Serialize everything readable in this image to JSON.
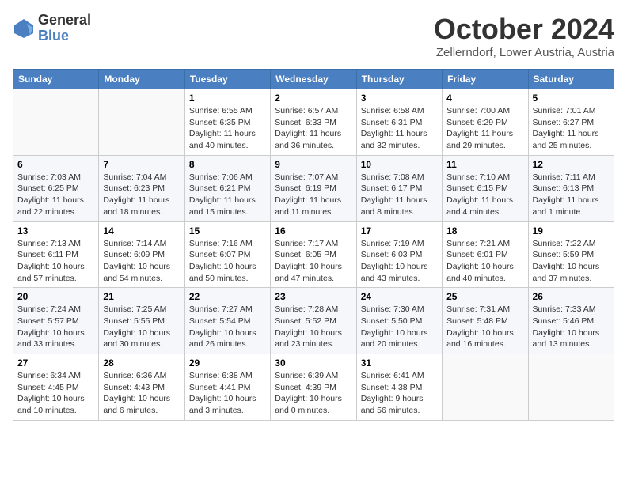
{
  "logo": {
    "general": "General",
    "blue": "Blue"
  },
  "title": "October 2024",
  "location": "Zellerndorf, Lower Austria, Austria",
  "days_of_week": [
    "Sunday",
    "Monday",
    "Tuesday",
    "Wednesday",
    "Thursday",
    "Friday",
    "Saturday"
  ],
  "weeks": [
    [
      {
        "day": "",
        "info": ""
      },
      {
        "day": "",
        "info": ""
      },
      {
        "day": "1",
        "info": "Sunrise: 6:55 AM\nSunset: 6:35 PM\nDaylight: 11 hours and 40 minutes."
      },
      {
        "day": "2",
        "info": "Sunrise: 6:57 AM\nSunset: 6:33 PM\nDaylight: 11 hours and 36 minutes."
      },
      {
        "day": "3",
        "info": "Sunrise: 6:58 AM\nSunset: 6:31 PM\nDaylight: 11 hours and 32 minutes."
      },
      {
        "day": "4",
        "info": "Sunrise: 7:00 AM\nSunset: 6:29 PM\nDaylight: 11 hours and 29 minutes."
      },
      {
        "day": "5",
        "info": "Sunrise: 7:01 AM\nSunset: 6:27 PM\nDaylight: 11 hours and 25 minutes."
      }
    ],
    [
      {
        "day": "6",
        "info": "Sunrise: 7:03 AM\nSunset: 6:25 PM\nDaylight: 11 hours and 22 minutes."
      },
      {
        "day": "7",
        "info": "Sunrise: 7:04 AM\nSunset: 6:23 PM\nDaylight: 11 hours and 18 minutes."
      },
      {
        "day": "8",
        "info": "Sunrise: 7:06 AM\nSunset: 6:21 PM\nDaylight: 11 hours and 15 minutes."
      },
      {
        "day": "9",
        "info": "Sunrise: 7:07 AM\nSunset: 6:19 PM\nDaylight: 11 hours and 11 minutes."
      },
      {
        "day": "10",
        "info": "Sunrise: 7:08 AM\nSunset: 6:17 PM\nDaylight: 11 hours and 8 minutes."
      },
      {
        "day": "11",
        "info": "Sunrise: 7:10 AM\nSunset: 6:15 PM\nDaylight: 11 hours and 4 minutes."
      },
      {
        "day": "12",
        "info": "Sunrise: 7:11 AM\nSunset: 6:13 PM\nDaylight: 11 hours and 1 minute."
      }
    ],
    [
      {
        "day": "13",
        "info": "Sunrise: 7:13 AM\nSunset: 6:11 PM\nDaylight: 10 hours and 57 minutes."
      },
      {
        "day": "14",
        "info": "Sunrise: 7:14 AM\nSunset: 6:09 PM\nDaylight: 10 hours and 54 minutes."
      },
      {
        "day": "15",
        "info": "Sunrise: 7:16 AM\nSunset: 6:07 PM\nDaylight: 10 hours and 50 minutes."
      },
      {
        "day": "16",
        "info": "Sunrise: 7:17 AM\nSunset: 6:05 PM\nDaylight: 10 hours and 47 minutes."
      },
      {
        "day": "17",
        "info": "Sunrise: 7:19 AM\nSunset: 6:03 PM\nDaylight: 10 hours and 43 minutes."
      },
      {
        "day": "18",
        "info": "Sunrise: 7:21 AM\nSunset: 6:01 PM\nDaylight: 10 hours and 40 minutes."
      },
      {
        "day": "19",
        "info": "Sunrise: 7:22 AM\nSunset: 5:59 PM\nDaylight: 10 hours and 37 minutes."
      }
    ],
    [
      {
        "day": "20",
        "info": "Sunrise: 7:24 AM\nSunset: 5:57 PM\nDaylight: 10 hours and 33 minutes."
      },
      {
        "day": "21",
        "info": "Sunrise: 7:25 AM\nSunset: 5:55 PM\nDaylight: 10 hours and 30 minutes."
      },
      {
        "day": "22",
        "info": "Sunrise: 7:27 AM\nSunset: 5:54 PM\nDaylight: 10 hours and 26 minutes."
      },
      {
        "day": "23",
        "info": "Sunrise: 7:28 AM\nSunset: 5:52 PM\nDaylight: 10 hours and 23 minutes."
      },
      {
        "day": "24",
        "info": "Sunrise: 7:30 AM\nSunset: 5:50 PM\nDaylight: 10 hours and 20 minutes."
      },
      {
        "day": "25",
        "info": "Sunrise: 7:31 AM\nSunset: 5:48 PM\nDaylight: 10 hours and 16 minutes."
      },
      {
        "day": "26",
        "info": "Sunrise: 7:33 AM\nSunset: 5:46 PM\nDaylight: 10 hours and 13 minutes."
      }
    ],
    [
      {
        "day": "27",
        "info": "Sunrise: 6:34 AM\nSunset: 4:45 PM\nDaylight: 10 hours and 10 minutes."
      },
      {
        "day": "28",
        "info": "Sunrise: 6:36 AM\nSunset: 4:43 PM\nDaylight: 10 hours and 6 minutes."
      },
      {
        "day": "29",
        "info": "Sunrise: 6:38 AM\nSunset: 4:41 PM\nDaylight: 10 hours and 3 minutes."
      },
      {
        "day": "30",
        "info": "Sunrise: 6:39 AM\nSunset: 4:39 PM\nDaylight: 10 hours and 0 minutes."
      },
      {
        "day": "31",
        "info": "Sunrise: 6:41 AM\nSunset: 4:38 PM\nDaylight: 9 hours and 56 minutes."
      },
      {
        "day": "",
        "info": ""
      },
      {
        "day": "",
        "info": ""
      }
    ]
  ]
}
